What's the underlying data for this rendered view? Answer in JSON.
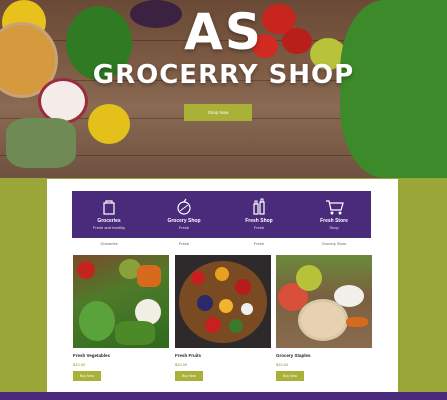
{
  "hero": {
    "title_line1": "AS",
    "title_line2": "GROCERRY SHOP",
    "button_label": "Shop Now"
  },
  "features": [
    {
      "title": "Groceries",
      "subtitle": "Fresh and healthy",
      "label": "Groceries"
    },
    {
      "title": "Grocery Shop",
      "subtitle": "Fresh",
      "label": "Fresh"
    },
    {
      "title": "Fresh Shop",
      "subtitle": "Fresh",
      "label": "Fresh"
    },
    {
      "title": "Fresh Store",
      "subtitle": "Shop",
      "label": "Grocery Store"
    }
  ],
  "cards": [
    {
      "title": "Fresh Vegetables",
      "price": "$10.00",
      "button": "Buy Now"
    },
    {
      "title": "Fresh Fruits",
      "price": "$10.00",
      "button": "Buy Now"
    },
    {
      "title": "Grocery Staples",
      "price": "$10.00",
      "button": "Buy Now"
    }
  ],
  "colors": {
    "accent": "#a9b138",
    "brand_purple": "#4a2a7a",
    "background": "#9aa637"
  }
}
